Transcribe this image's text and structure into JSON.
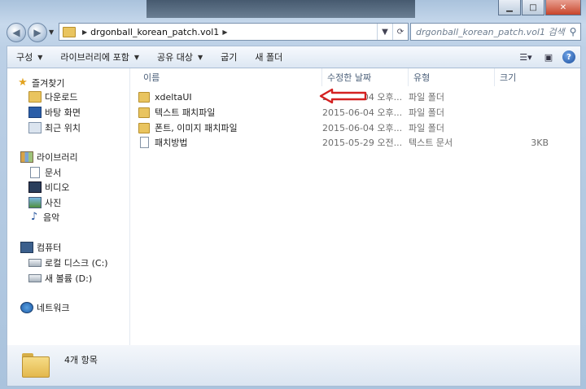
{
  "window": {
    "accent": "#c7452b",
    "caption": {
      "minimize_icon": "minimize-icon",
      "maximize_icon": "maximize-icon",
      "close_icon": "close-icon"
    }
  },
  "address_bar": {
    "breadcrumb": [
      "drgonball_korean_patch.vol1"
    ],
    "search_placeholder": "drgonball_korean_patch.vol1 검색"
  },
  "toolbar": {
    "organize": "구성",
    "include_library": "라이브러리에 포함",
    "share_with": "공유 대상",
    "burn": "굽기",
    "new_folder": "새 폴더"
  },
  "sidebar": {
    "favorites": {
      "label": "즐겨찾기",
      "items": [
        "다운로드",
        "바탕 화면",
        "최근 위치"
      ]
    },
    "libraries": {
      "label": "라이브러리",
      "items": [
        "문서",
        "비디오",
        "사진",
        "음악"
      ]
    },
    "computer": {
      "label": "컴퓨터",
      "items": [
        "로컬 디스크 (C:)",
        "새 볼륨 (D:)"
      ]
    },
    "network": {
      "label": "네트워크"
    }
  },
  "file_list": {
    "columns": {
      "name": "이름",
      "date": "수정한 날짜",
      "type": "유형",
      "size": "크기"
    },
    "rows": [
      {
        "name": "xdeltaUI",
        "date": "2015-06-04 오후...",
        "type": "파일 폴더",
        "size": "",
        "icon": "folder-icon"
      },
      {
        "name": "텍스트 패치파일",
        "date": "2015-06-04 오후...",
        "type": "파일 폴더",
        "size": "",
        "icon": "folder-icon"
      },
      {
        "name": "폰트, 이미지 패치파일",
        "date": "2015-06-04 오후...",
        "type": "파일 폴더",
        "size": "",
        "icon": "folder-icon"
      },
      {
        "name": "패치방법",
        "date": "2015-05-29 오전...",
        "type": "텍스트 문서",
        "size": "3KB",
        "icon": "text-file-icon"
      }
    ]
  },
  "annotation": {
    "color": "#d42020",
    "points_to": "xdeltaUI"
  },
  "details_pane": {
    "item_count": "4개 항목"
  }
}
